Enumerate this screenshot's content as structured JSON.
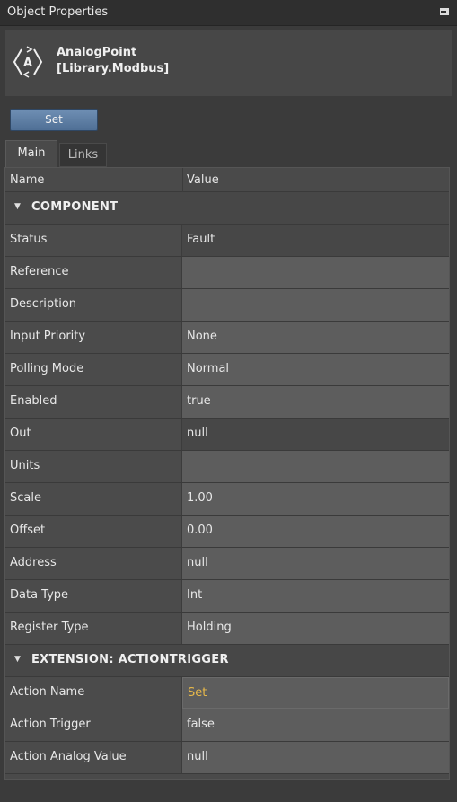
{
  "window": {
    "title": "Object Properties"
  },
  "object": {
    "name": "AnalogPoint",
    "library": "[Library.Modbus]",
    "icon": "analog-point-icon"
  },
  "toolbar": {
    "set_label": "Set"
  },
  "tabs": [
    {
      "label": "Main",
      "active": true
    },
    {
      "label": "Links",
      "active": false
    }
  ],
  "grid": {
    "headers": {
      "name": "Name",
      "value": "Value"
    },
    "sections": [
      {
        "label": "COMPONENT",
        "rows": [
          {
            "name": "Status",
            "value": "Fault"
          },
          {
            "name": "Reference",
            "value": ""
          },
          {
            "name": "Description",
            "value": ""
          },
          {
            "name": "Input Priority",
            "value": "None"
          },
          {
            "name": "Polling Mode",
            "value": "Normal"
          },
          {
            "name": "Enabled",
            "value": "true"
          },
          {
            "name": "Out",
            "value": "null"
          },
          {
            "name": "Units",
            "value": ""
          },
          {
            "name": "Scale",
            "value": "1.00"
          },
          {
            "name": "Offset",
            "value": "0.00"
          },
          {
            "name": "Address",
            "value": "null"
          },
          {
            "name": "Data Type",
            "value": "Int"
          },
          {
            "name": "Register Type",
            "value": "Holding"
          }
        ]
      },
      {
        "label": "EXTENSION: ACTIONTRIGGER",
        "rows": [
          {
            "name": "Action Name",
            "value": "Set"
          },
          {
            "name": "Action Trigger",
            "value": "false"
          },
          {
            "name": "Action Analog Value",
            "value": "null"
          }
        ]
      }
    ]
  },
  "colors": {
    "accent_value": "#e8b94a",
    "button": "#5f7fa6",
    "panel": "#3b3b3b"
  }
}
